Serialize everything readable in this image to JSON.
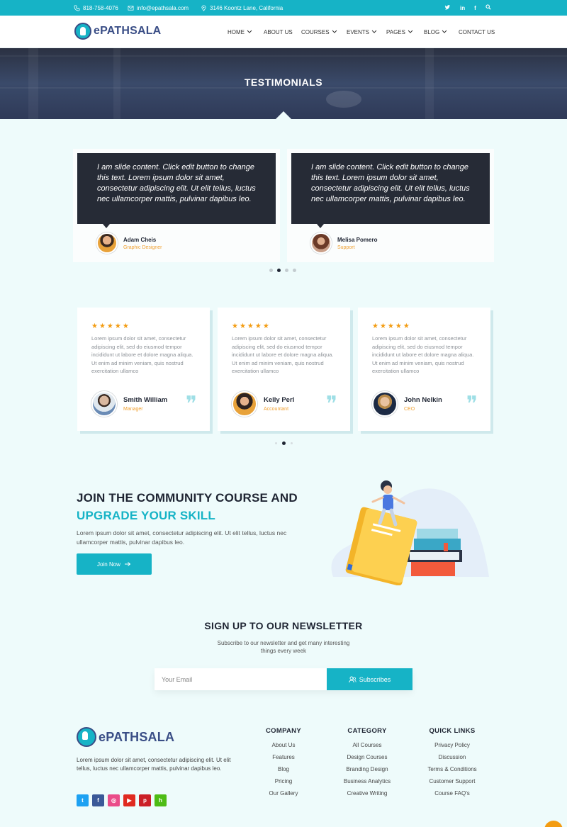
{
  "topbar": {
    "phone": "818-758-4076",
    "email": "info@epathsala.com",
    "address": "3146 Koontz Lane, California",
    "social_icons": [
      "twitter-icon",
      "linkedin-icon",
      "facebook-icon",
      "search-icon"
    ]
  },
  "brand": {
    "name": "ePATHSALA"
  },
  "nav": [
    {
      "label": "HOME"
    },
    {
      "label": "ABOUT US"
    },
    {
      "label": "COURSES"
    },
    {
      "label": "EVENTS"
    },
    {
      "label": "PAGES"
    },
    {
      "label": "BLOG"
    },
    {
      "label": "CONTACT US"
    }
  ],
  "hero": {
    "title": "TESTIMONIALS"
  },
  "testimonials_1": [
    {
      "text": "I am slide content. Click edit button to change this text. Lorem ipsum dolor sit amet, consectetur adipiscing elit. Ut elit tellus, luctus nec ullamcorper mattis, pulvinar dapibus leo.",
      "name": "Adam Cheis",
      "role": "Graphic Designer"
    },
    {
      "text": "I am slide content. Click edit button to change this text. Lorem ipsum dolor sit amet, consectetur adipiscing elit. Ut elit tellus, luctus nec ullamcorper mattis, pulvinar dapibus leo.",
      "name": "Melisa Pomero",
      "role": "Support"
    }
  ],
  "testimonials_2": [
    {
      "stars": "★★★★★",
      "text": "Lorem ipsum dolor sit amet, consectetur adipiscing elit, sed do eiusmod tempor incididunt ut labore et dolore magna aliqua. Ut enim ad minim veniam, quis nostrud exercitation ullamco",
      "name": "Smith William",
      "role": "Manager"
    },
    {
      "stars": "★★★★★",
      "text": "Lorem ipsum dolor sit amet, consectetur adipiscing elit, sed do eiusmod tempor incididunt ut labore et dolore magna aliqua. Ut enim ad minim veniam, quis nostrud exercitation ullamco",
      "name": "Kelly Perl",
      "role": "Accountant"
    },
    {
      "stars": "★★★★★",
      "text": "Lorem ipsum dolor sit amet, consectetur adipiscing elit, sed do eiusmod tempor incididunt ut labore et dolore magna aliqua. Ut enim ad minim veniam, quis nostrud exercitation ullamco",
      "name": "John Nelkin",
      "role": "CEO"
    }
  ],
  "cta": {
    "title_line1": "JOIN THE COMMUNITY COURSE AND",
    "title_line2": "UPGRADE YOUR SKILL",
    "text": "Lorem ipsum dolor sit amet, consectetur adipiscing elit. Ut elit tellus, luctus nec ullamcorper mattis, pulvinar dapibus leo.",
    "button": "Join Now"
  },
  "newsletter": {
    "title": "SIGN UP TO OUR NEWSLETTER",
    "subtitle": "Subscribe to our newsletter and get many interesting things every week",
    "placeholder": "Your Email",
    "button": "Subscribes"
  },
  "footer": {
    "brand": "ePATHSALA",
    "text": "Lorem ipsum dolor sit amet, consectetur adipiscing elit. Ut elit tellus, luctus nec ullamcorper mattis, pulvinar dapibus leo.",
    "social_icons": [
      "twitter-icon",
      "facebook-icon",
      "dribbble-icon",
      "youtube-icon",
      "pinterest-icon",
      "houzz-icon"
    ],
    "social_colors": [
      "#1da1f2",
      "#3b5998",
      "#ea4c89",
      "#e02a20",
      "#cb2027",
      "#4dbc15"
    ],
    "columns": [
      {
        "heading": "COMPANY",
        "links": [
          "About Us",
          "Features",
          "Blog",
          "Pricing",
          "Our Gallery"
        ]
      },
      {
        "heading": "CATEGORY",
        "links": [
          "All Courses",
          "Design Courses",
          "Branding Design",
          "Business Analytics",
          "Creative Writing"
        ]
      },
      {
        "heading": "QUICK LINKS",
        "links": [
          "Privacy Policy",
          "Discussion",
          "Terms & Conditions",
          "Customer Support",
          "Course FAQ's"
        ]
      }
    ]
  },
  "colors": {
    "accent": "#16b3c6",
    "dark": "#1f2533",
    "star": "#f39c12",
    "brand": "#3a4e86"
  }
}
